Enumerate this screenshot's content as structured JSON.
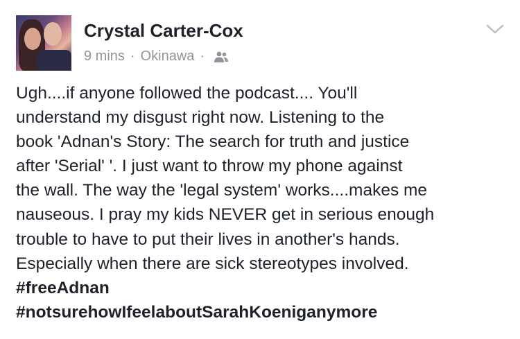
{
  "post": {
    "author": "Crystal Carter-Cox",
    "time": "9 mins",
    "separator": "·",
    "location": "Okinawa",
    "audience_icon": "friends-icon",
    "menu_icon": "chevron-down-icon",
    "body_lines": [
      "Ugh....if anyone followed the podcast.... You'll",
      "understand my disgust right now. Listening to the",
      "book 'Adnan's Story: The search for truth and justice",
      "after 'Serial' '. I just want to throw my phone against",
      "the wall. The way the 'legal system' works....makes me",
      "nauseous. I pray my kids NEVER get in serious enough",
      "trouble to have to put their lives in another's hands.",
      "Especially when there are sick stereotypes involved."
    ],
    "hashtags": [
      "#freeAdnan",
      "#notsurehowIfeelaboutSarahKoeniganymore"
    ]
  },
  "colors": {
    "text": "#1d2129",
    "meta": "#90949c",
    "background": "#ffffff"
  }
}
